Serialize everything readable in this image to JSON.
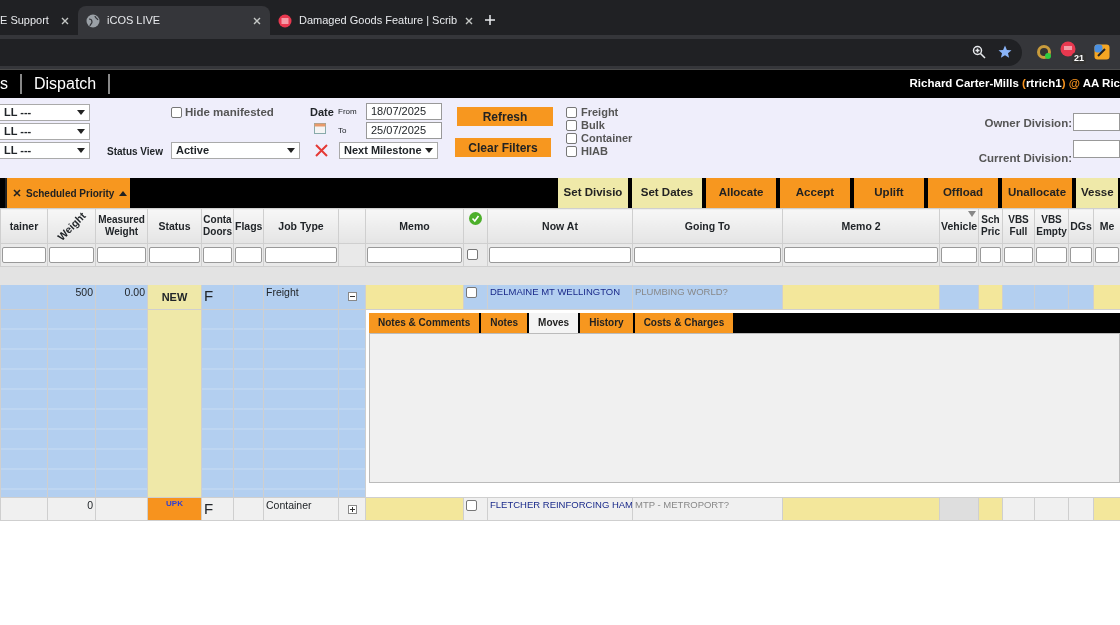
{
  "browser": {
    "tabs": [
      {
        "title": "E Support",
        "selected": false
      },
      {
        "title": "iCOS LIVE",
        "selected": true
      },
      {
        "title": "Damaged Goods Feature | Scrib",
        "selected": false
      }
    ],
    "extension_badge": "21"
  },
  "app_bar": {
    "nav": [
      "s",
      "Dispatch"
    ],
    "user": [
      {
        "text": "Richard Carter-Mills ",
        "kind": "plain"
      },
      {
        "text": "(",
        "kind": "accent"
      },
      {
        "text": "rtrich1",
        "kind": "plain"
      },
      {
        "text": ")",
        "kind": "accent"
      },
      {
        "text": " @ ",
        "kind": "accent"
      },
      {
        "text": "AA Ric",
        "kind": "plain"
      }
    ]
  },
  "filters": {
    "selects": [
      "LL ---",
      "LL ---",
      "LL ---"
    ],
    "hide_manifested": {
      "label": "Hide manifested",
      "checked": false
    },
    "status_view": {
      "label": "Status View",
      "value": "Active"
    },
    "date": {
      "label": "Date",
      "from_label": "From",
      "from": "18/07/2025",
      "to_label": "To",
      "to": "25/07/2025",
      "milestone": "Next Milestone"
    },
    "buttons": [
      "Refresh",
      "Clear Filters"
    ],
    "job_types": [
      {
        "label": "Freight",
        "checked": false
      },
      {
        "label": "Bulk",
        "checked": false
      },
      {
        "label": "Container",
        "checked": false
      },
      {
        "label": "HIAB",
        "checked": false
      }
    ],
    "divisions": [
      "Owner Division:",
      "Current Division:"
    ]
  },
  "toolbar": {
    "sort_chip": "Scheduled Priority",
    "actions": [
      {
        "label": "Set Divisio",
        "color": "#efe9a9"
      },
      {
        "label": "Set Dates",
        "color": "#efe9a9"
      },
      {
        "label": "Allocate",
        "color": "#f7971f"
      },
      {
        "label": "Accept",
        "color": "#f7971f"
      },
      {
        "label": "Uplift",
        "color": "#f7971f"
      },
      {
        "label": "Offload",
        "color": "#f7971f"
      },
      {
        "label": "Unallocate",
        "color": "#f7971f"
      },
      {
        "label": "Vesse",
        "color": "#efe9a9"
      }
    ]
  },
  "table": {
    "select_all_checked": false,
    "columns": [
      {
        "lines": [
          "tainer"
        ],
        "kind": "text",
        "sorted": false
      },
      {
        "lines": [
          "Weight"
        ],
        "kind": "rotated",
        "sorted": false
      },
      {
        "lines": [
          "Measured",
          "Weight"
        ],
        "kind": "text",
        "sorted": false
      },
      {
        "lines": [
          "Status"
        ],
        "kind": "text",
        "sorted": false
      },
      {
        "lines": [
          "Conta",
          "Doors"
        ],
        "kind": "text",
        "sorted": false
      },
      {
        "lines": [
          "Flags"
        ],
        "kind": "text",
        "sorted": false
      },
      {
        "lines": [
          "Job Type"
        ],
        "kind": "text",
        "sorted": false
      },
      {
        "kind": "blank",
        "sorted": false
      },
      {
        "lines": [
          "Memo"
        ],
        "kind": "text",
        "sorted": false
      },
      {
        "kind": "icon",
        "sorted": false
      },
      {
        "lines": [
          "Now At"
        ],
        "kind": "text",
        "sorted": false
      },
      {
        "lines": [
          "Going To"
        ],
        "kind": "text",
        "sorted": false
      },
      {
        "lines": [
          "Memo 2"
        ],
        "kind": "text",
        "sorted": false
      },
      {
        "lines": [
          "Vehicle"
        ],
        "kind": "text",
        "sorted": true
      },
      {
        "lines": [
          "Sch",
          "Pric"
        ],
        "kind": "text",
        "sorted": false
      },
      {
        "lines": [
          "VBS",
          "Full"
        ],
        "kind": "text",
        "sorted": false
      },
      {
        "lines": [
          "VBS",
          "Empty"
        ],
        "kind": "text",
        "sorted": false
      },
      {
        "lines": [
          "DGs"
        ],
        "kind": "text",
        "sorted": false
      },
      {
        "lines": [
          "Me"
        ],
        "kind": "text",
        "sorted": false
      }
    ],
    "rows": [
      {
        "selected": true,
        "expanded": true,
        "checked": false,
        "cells": [
          {
            "kind": "blank"
          },
          {
            "kind": "num",
            "text": "500"
          },
          {
            "kind": "num",
            "text": "0.00"
          },
          {
            "kind": "status",
            "text": "NEW",
            "color": "#efe8a8"
          },
          {
            "kind": "big",
            "text": "F"
          },
          {
            "kind": "blank"
          },
          {
            "kind": "text",
            "text": "Freight"
          },
          {
            "kind": "expander"
          },
          {
            "kind": "hl"
          },
          {
            "kind": "check"
          },
          {
            "kind": "link",
            "text": "DELMAINE MT WELLINGTON"
          },
          {
            "kind": "muted",
            "text": "PLUMBING WORLD?"
          },
          {
            "kind": "hl"
          },
          {
            "kind": "blank"
          },
          {
            "kind": "hl"
          },
          {
            "kind": "blank"
          },
          {
            "kind": "blank"
          },
          {
            "kind": "blank"
          },
          {
            "kind": "hl"
          }
        ]
      },
      {
        "selected": false,
        "expanded": false,
        "checked": false,
        "cells": [
          {
            "kind": "blank"
          },
          {
            "kind": "num",
            "text": "0"
          },
          {
            "kind": "blank"
          },
          {
            "kind": "status",
            "text": "UPK",
            "color": "#f7931e"
          },
          {
            "kind": "big",
            "text": "F"
          },
          {
            "kind": "blank"
          },
          {
            "kind": "text",
            "text": "Container"
          },
          {
            "kind": "expander"
          },
          {
            "kind": "hl"
          },
          {
            "kind": "check"
          },
          {
            "kind": "link",
            "text": "FLETCHER REINFORCING HAM"
          },
          {
            "kind": "muted",
            "text": "MTP - METROPORT?"
          },
          {
            "kind": "hl"
          },
          {
            "kind": "shade"
          },
          {
            "kind": "hl"
          },
          {
            "kind": "blank"
          },
          {
            "kind": "blank"
          },
          {
            "kind": "blank"
          },
          {
            "kind": "hl"
          }
        ]
      }
    ]
  },
  "detail_panel": {
    "tabs": [
      {
        "label": "Notes & Comments",
        "selected": false
      },
      {
        "label": "Notes",
        "selected": false
      },
      {
        "label": "Moves",
        "selected": true
      },
      {
        "label": "History",
        "selected": false
      },
      {
        "label": "Costs & Charges",
        "selected": false
      }
    ]
  }
}
